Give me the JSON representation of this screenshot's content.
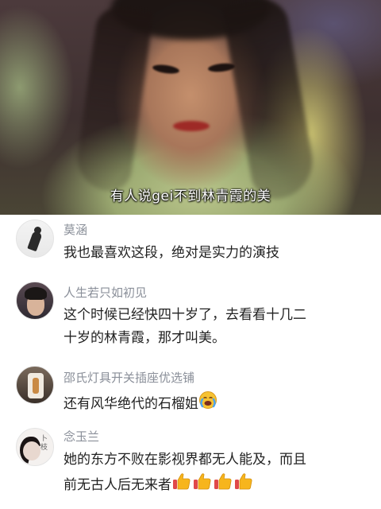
{
  "video": {
    "subtitle": "有人说gei不到林青霞的美"
  },
  "comments": [
    {
      "username": "莫涵",
      "lines": [
        "我也最喜欢这段，绝对是实力的演技"
      ],
      "avatar": "silhouette-avatar"
    },
    {
      "username": "人生若只如初见",
      "lines": [
        "这个时候已经快四十岁了，去看看十几二",
        "十岁的林青霞，那才叫美。"
      ],
      "avatar": "man-portrait-avatar"
    },
    {
      "username": "邵氏灯具开关插座优选铺",
      "lines": [
        "还有风华绝代的石榴姐"
      ],
      "emoji": "crying-face-emoji",
      "avatar": "store-logo-avatar"
    },
    {
      "username": "念玉兰",
      "lines": [
        "她的东方不败在影视界都无人能及，而且",
        "前无古人后无来者"
      ],
      "emoji": "thumbs-up-emoji",
      "emoji_count": 4,
      "avatar": "woman-portrait-avatar"
    }
  ],
  "colors": {
    "username": "#8a8f99",
    "text": "#222222",
    "thumbs_up": "#f7b51c",
    "crying_face": "#f6c233",
    "tears": "#4aa3f0"
  }
}
